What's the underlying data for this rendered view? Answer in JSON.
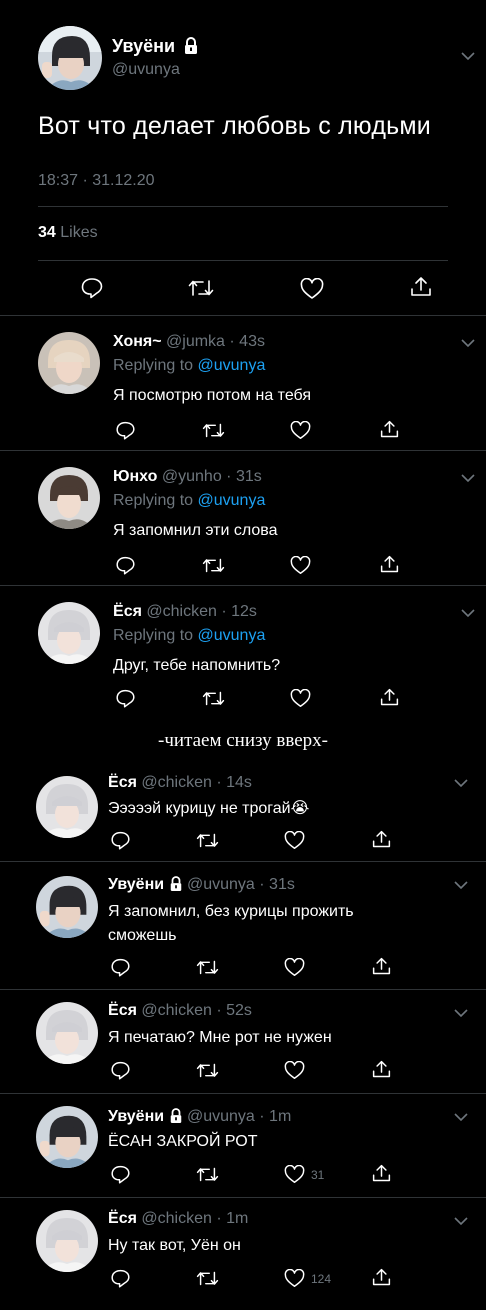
{
  "main_tweet": {
    "name": "Увуёни",
    "handle": "@uvunya",
    "text": "Вот что делает любовь с людьми",
    "timestamp": "18:37 · 31.12.20",
    "likes_count": "34",
    "likes_label": "Likes"
  },
  "replies_top": [
    {
      "name": "Хоня~",
      "meta": "@jumka · 43s",
      "replying_label": "Replying to",
      "replying_to": "@uvunya",
      "text": "Я посмотрю потом на тебя"
    },
    {
      "name": "Юнхо",
      "meta": "@yunho · 31s",
      "replying_label": "Replying to",
      "replying_to": "@uvunya",
      "text": "Я запомнил эти слова"
    },
    {
      "name": "Ёся",
      "meta": "@chicken · 12s",
      "replying_label": "Replying to",
      "replying_to": "@uvunya",
      "text": "Друг, тебе напомнить?"
    }
  ],
  "caption": "-читаем снизу вверх-",
  "replies_bottom": [
    {
      "name": "Ёся",
      "meta": "@chicken · 14s",
      "text": "Эээээй курицу не трогай",
      "emoji": "😭",
      "like_count": ""
    },
    {
      "name": "Увуёни",
      "lock": true,
      "meta": "@uvunya · 31s",
      "text_line1": "Я запомнил, без курицы прожить",
      "text_line2": "сможешь",
      "like_count": ""
    },
    {
      "name": "Ёся",
      "meta": "@chicken · 52s",
      "text": "Я печатаю? Мне рот не нужен",
      "like_count": ""
    },
    {
      "name": "Увуёни",
      "lock": true,
      "meta": "@uvunya · 1m",
      "text": "ЁСАН ЗАКРОЙ РОТ",
      "like_count": "31"
    },
    {
      "name": "Ёся",
      "meta": "@chicken · 1m",
      "text": "Ну так вот, Уён он",
      "like_count": "124"
    }
  ],
  "colors": {
    "background": "#000000",
    "muted": "#6e767d",
    "link": "#1da1f2",
    "divider": "#2f3336"
  }
}
